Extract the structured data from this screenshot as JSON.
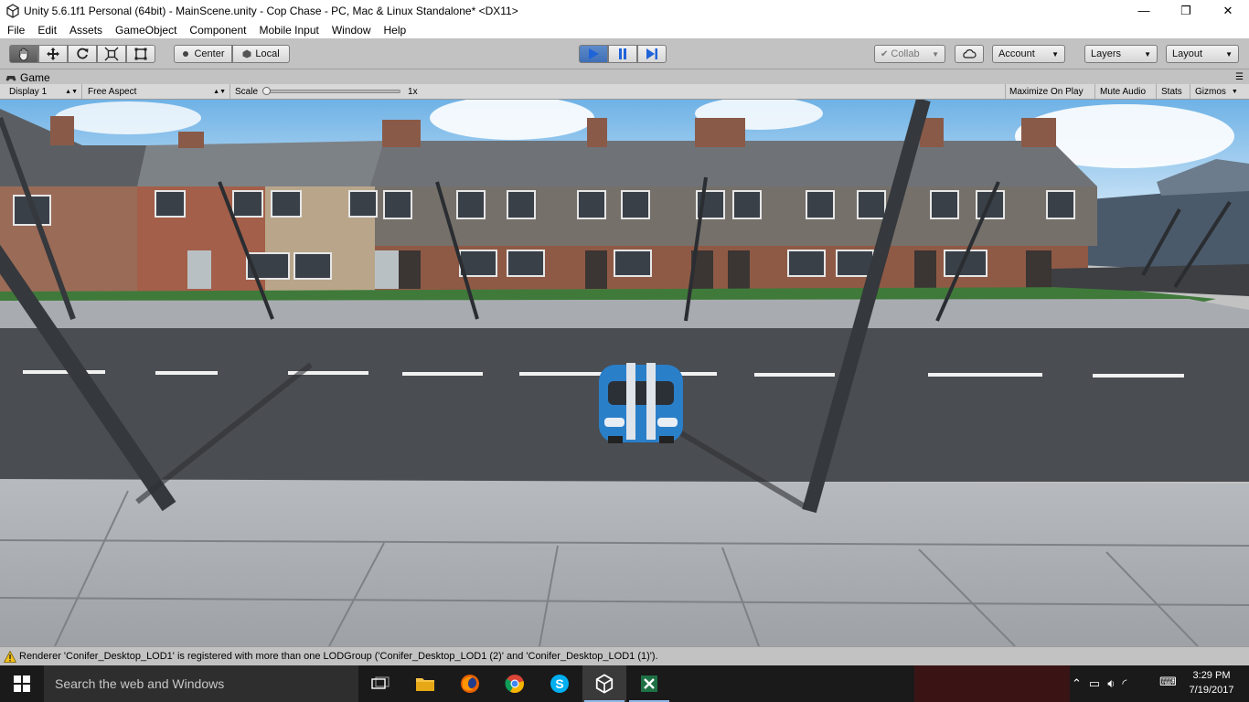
{
  "window": {
    "title": "Unity 5.6.1f1 Personal (64bit) - MainScene.unity - Cop Chase - PC, Mac & Linux Standalone* <DX11>",
    "minimize": "—",
    "restore": "❐",
    "close": "✕"
  },
  "menu": [
    "File",
    "Edit",
    "Assets",
    "GameObject",
    "Component",
    "Mobile Input",
    "Window",
    "Help"
  ],
  "toolbar": {
    "pivot_label": "Center",
    "space_label": "Local",
    "collab_label": "Collab",
    "account_label": "Account",
    "layers_label": "Layers",
    "layout_label": "Layout"
  },
  "game_tab": {
    "title": "Game",
    "display": "Display 1",
    "aspect": "Free Aspect",
    "scale_label": "Scale",
    "scale_value": "1x",
    "scale_fraction": 0.0,
    "maximize_on_play": "Maximize On Play",
    "mute_audio": "Mute Audio",
    "stats": "Stats",
    "gizmos": "Gizmos"
  },
  "console": {
    "warning": "Renderer 'Conifer_Desktop_LOD1' is registered with more than one LODGroup ('Conifer_Desktop_LOD1 (2)' and 'Conifer_Desktop_LOD1 (1)')."
  },
  "taskbar": {
    "search_placeholder": "Search the web and Windows",
    "time": "3:29 PM",
    "date": "7/19/2017"
  },
  "colors": {
    "play_active": "#3f6fb6",
    "sky": "#8fc4ee",
    "road": "#4a4d52",
    "sidewalk": "#a9adb2",
    "car_blue": "#2a7fc9"
  }
}
